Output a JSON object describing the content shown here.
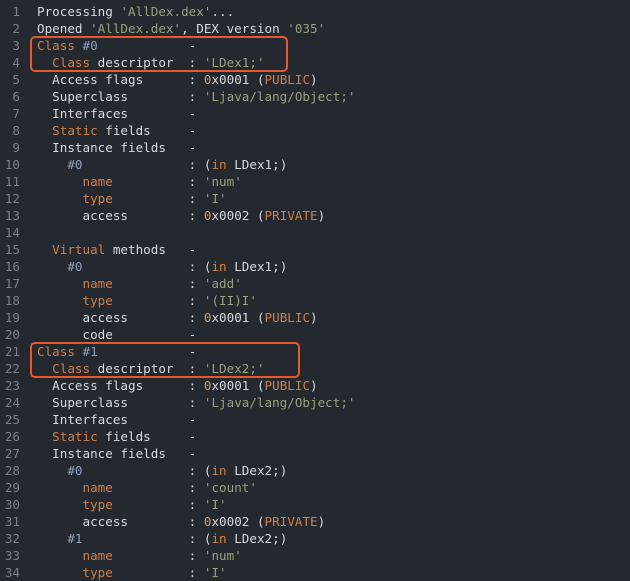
{
  "lines": [
    {
      "n": "1",
      "indent": 0,
      "parts": [
        [
          "def",
          "Processing "
        ],
        [
          "str",
          "'AllDex.dex'"
        ],
        [
          "def",
          "..."
        ]
      ]
    },
    {
      "n": "2",
      "indent": 0,
      "parts": [
        [
          "def",
          "Opened "
        ],
        [
          "str",
          "'AllDex.dex'"
        ],
        [
          "def",
          ", DEX version "
        ],
        [
          "str",
          "'035'"
        ]
      ]
    },
    {
      "n": "3",
      "indent": 0,
      "parts": [
        [
          "kw",
          "Class"
        ],
        [
          "def",
          " "
        ],
        [
          "dim",
          "#0"
        ]
      ],
      "sep": "-"
    },
    {
      "n": "4",
      "indent": 2,
      "parts": [
        [
          "kw",
          "Class"
        ],
        [
          "def",
          " descriptor"
        ]
      ],
      "sep": ":",
      "value": [
        [
          "str",
          "'LDex1;'"
        ]
      ]
    },
    {
      "n": "5",
      "indent": 2,
      "parts": [
        [
          "def",
          "Access flags"
        ]
      ],
      "sep": ":",
      "value": [
        [
          "num",
          "0"
        ],
        [
          "def",
          "x0001 ("
        ],
        [
          "kw",
          "PUBLIC"
        ],
        [
          "def",
          ")"
        ]
      ]
    },
    {
      "n": "6",
      "indent": 2,
      "parts": [
        [
          "def",
          "Superclass"
        ]
      ],
      "sep": ":",
      "value": [
        [
          "str",
          "'Ljava/lang/Object;'"
        ]
      ]
    },
    {
      "n": "7",
      "indent": 2,
      "parts": [
        [
          "def",
          "Interfaces"
        ]
      ],
      "sep": "-"
    },
    {
      "n": "8",
      "indent": 2,
      "parts": [
        [
          "kw",
          "Static"
        ],
        [
          "def",
          " fields"
        ]
      ],
      "sep": "-"
    },
    {
      "n": "9",
      "indent": 2,
      "parts": [
        [
          "def",
          "Instance fields"
        ]
      ],
      "sep": "-"
    },
    {
      "n": "10",
      "indent": 4,
      "parts": [
        [
          "dim",
          "#0"
        ]
      ],
      "sep": ":",
      "value": [
        [
          "def",
          "("
        ],
        [
          "kw",
          "in"
        ],
        [
          "def",
          " LDex1;)"
        ]
      ]
    },
    {
      "n": "11",
      "indent": 6,
      "parts": [
        [
          "kw",
          "name"
        ]
      ],
      "sep": ":",
      "value": [
        [
          "str",
          "'num'"
        ]
      ]
    },
    {
      "n": "12",
      "indent": 6,
      "parts": [
        [
          "kw",
          "type"
        ]
      ],
      "sep": ":",
      "value": [
        [
          "str",
          "'I'"
        ]
      ]
    },
    {
      "n": "13",
      "indent": 6,
      "parts": [
        [
          "def",
          "access"
        ]
      ],
      "sep": ":",
      "value": [
        [
          "num",
          "0"
        ],
        [
          "def",
          "x0002 ("
        ],
        [
          "kw",
          "PRIVATE"
        ],
        [
          "def",
          ")"
        ]
      ]
    },
    {
      "n": "14",
      "indent": 0,
      "parts": []
    },
    {
      "n": "15",
      "indent": 2,
      "parts": [
        [
          "kw",
          "Virtual"
        ],
        [
          "def",
          " methods"
        ]
      ],
      "sep": "-"
    },
    {
      "n": "16",
      "indent": 4,
      "parts": [
        [
          "dim",
          "#0"
        ]
      ],
      "sep": ":",
      "value": [
        [
          "def",
          "("
        ],
        [
          "kw",
          "in"
        ],
        [
          "def",
          " LDex1;)"
        ]
      ]
    },
    {
      "n": "17",
      "indent": 6,
      "parts": [
        [
          "kw",
          "name"
        ]
      ],
      "sep": ":",
      "value": [
        [
          "str",
          "'add'"
        ]
      ]
    },
    {
      "n": "18",
      "indent": 6,
      "parts": [
        [
          "kw",
          "type"
        ]
      ],
      "sep": ":",
      "value": [
        [
          "str",
          "'(II)I'"
        ]
      ]
    },
    {
      "n": "19",
      "indent": 6,
      "parts": [
        [
          "def",
          "access"
        ]
      ],
      "sep": ":",
      "value": [
        [
          "num",
          "0"
        ],
        [
          "def",
          "x0001 ("
        ],
        [
          "kw",
          "PUBLIC"
        ],
        [
          "def",
          ")"
        ]
      ]
    },
    {
      "n": "20",
      "indent": 6,
      "parts": [
        [
          "def",
          "code"
        ]
      ],
      "sep": "-"
    },
    {
      "n": "21",
      "indent": 0,
      "parts": [
        [
          "kw",
          "Class"
        ],
        [
          "def",
          " "
        ],
        [
          "dim",
          "#1"
        ]
      ],
      "sep": "-"
    },
    {
      "n": "22",
      "indent": 2,
      "parts": [
        [
          "kw",
          "Class"
        ],
        [
          "def",
          " descriptor"
        ]
      ],
      "sep": ":",
      "value": [
        [
          "str",
          "'LDex2;'"
        ]
      ]
    },
    {
      "n": "23",
      "indent": 2,
      "parts": [
        [
          "def",
          "Access flags"
        ]
      ],
      "sep": ":",
      "value": [
        [
          "num",
          "0"
        ],
        [
          "def",
          "x0001 ("
        ],
        [
          "kw",
          "PUBLIC"
        ],
        [
          "def",
          ")"
        ]
      ]
    },
    {
      "n": "24",
      "indent": 2,
      "parts": [
        [
          "def",
          "Superclass"
        ]
      ],
      "sep": ":",
      "value": [
        [
          "str",
          "'Ljava/lang/Object;'"
        ]
      ]
    },
    {
      "n": "25",
      "indent": 2,
      "parts": [
        [
          "def",
          "Interfaces"
        ]
      ],
      "sep": "-"
    },
    {
      "n": "26",
      "indent": 2,
      "parts": [
        [
          "kw",
          "Static"
        ],
        [
          "def",
          " fields"
        ]
      ],
      "sep": "-"
    },
    {
      "n": "27",
      "indent": 2,
      "parts": [
        [
          "def",
          "Instance fields"
        ]
      ],
      "sep": "-"
    },
    {
      "n": "28",
      "indent": 4,
      "parts": [
        [
          "dim",
          "#0"
        ]
      ],
      "sep": ":",
      "value": [
        [
          "def",
          "("
        ],
        [
          "kw",
          "in"
        ],
        [
          "def",
          " LDex2;)"
        ]
      ]
    },
    {
      "n": "29",
      "indent": 6,
      "parts": [
        [
          "kw",
          "name"
        ]
      ],
      "sep": ":",
      "value": [
        [
          "str",
          "'count'"
        ]
      ]
    },
    {
      "n": "30",
      "indent": 6,
      "parts": [
        [
          "kw",
          "type"
        ]
      ],
      "sep": ":",
      "value": [
        [
          "str",
          "'I'"
        ]
      ]
    },
    {
      "n": "31",
      "indent": 6,
      "parts": [
        [
          "def",
          "access"
        ]
      ],
      "sep": ":",
      "value": [
        [
          "num",
          "0"
        ],
        [
          "def",
          "x0002 ("
        ],
        [
          "kw",
          "PRIVATE"
        ],
        [
          "def",
          ")"
        ]
      ]
    },
    {
      "n": "32",
      "indent": 4,
      "parts": [
        [
          "dim",
          "#1"
        ]
      ],
      "sep": ":",
      "value": [
        [
          "def",
          "("
        ],
        [
          "kw",
          "in"
        ],
        [
          "def",
          " LDex2;)"
        ]
      ]
    },
    {
      "n": "33",
      "indent": 6,
      "parts": [
        [
          "kw",
          "name"
        ]
      ],
      "sep": ":",
      "value": [
        [
          "str",
          "'num'"
        ]
      ]
    },
    {
      "n": "34",
      "indent": 6,
      "parts": [
        [
          "kw",
          "type"
        ]
      ],
      "sep": ":",
      "value": [
        [
          "str",
          "'I'"
        ]
      ]
    }
  ],
  "highlights": [
    "class-0-header",
    "class-1-header"
  ],
  "colors": {
    "background": "#24282f",
    "text": "#d7dadf",
    "string": "#9aa17f",
    "number": "#cf9a6b",
    "keyword": "#d1804a",
    "line_number": "#7b8089",
    "highlight_border": "#e45a2e"
  }
}
